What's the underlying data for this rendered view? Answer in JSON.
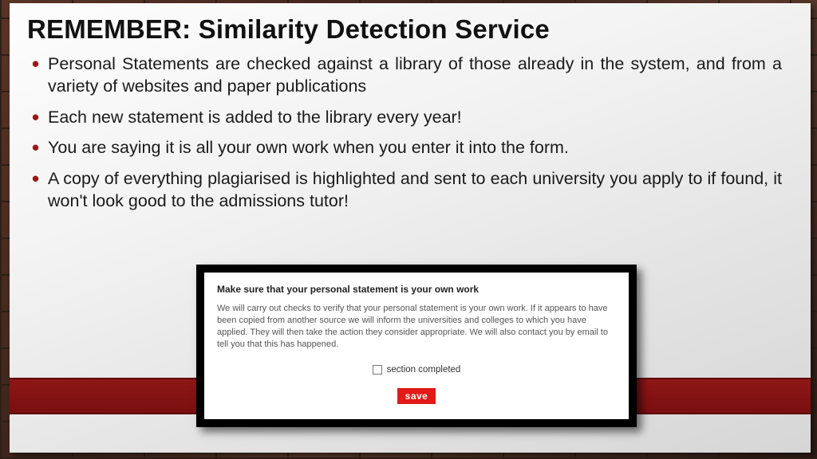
{
  "title_lead": "REMEMBER:",
  "title_rest": " Similarity Detection Service",
  "bullets": [
    "Personal Statements are checked against a library of those already in the system, and from a variety of websites and paper publications",
    "Each new statement is added to the library every year!",
    "You are saying it is all your own work when you enter it into the form.",
    "A copy of everything plagiarised is highlighted and sent to each university you apply to if found, it won't look good to the admissions tutor!"
  ],
  "panel": {
    "heading": "Make sure that your personal statement is your own work",
    "body": "We will carry out checks to verify that your personal statement is your own work. If it appears to have been copied from another source we will inform the universities and colleges to which you have applied. They will then take the action they consider appropriate. We will also contact you by email to tell you that this has happened.",
    "checkbox_label": "section completed",
    "save_label": "save"
  }
}
